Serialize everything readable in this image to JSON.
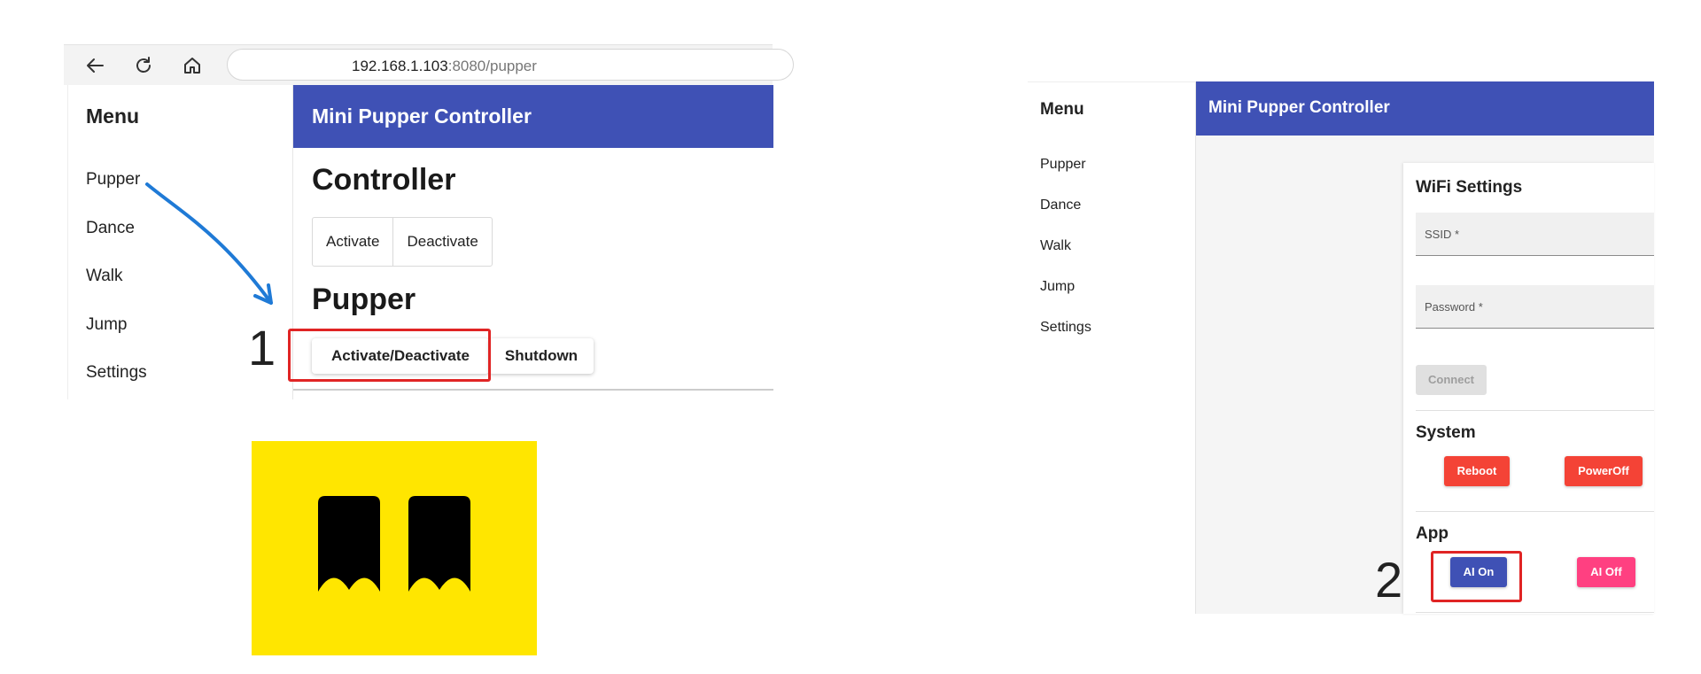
{
  "left_screenshot": {
    "browser": {
      "url_host": "192.168.1.103",
      "url_rest": ":8080/pupper",
      "icons": [
        "back-arrow-icon",
        "reload-icon",
        "home-icon"
      ]
    },
    "menu": {
      "title": "Menu",
      "items": [
        "Pupper",
        "Dance",
        "Walk",
        "Jump",
        "Settings"
      ]
    },
    "header_title": "Mini Pupper Controller",
    "controller": {
      "heading": "Controller",
      "buttons": [
        "Activate",
        "Deactivate"
      ]
    },
    "pupper": {
      "heading": "Pupper",
      "buttons": [
        "Activate/Deactivate",
        "Shutdown"
      ]
    },
    "callout_number": "1"
  },
  "right_screenshot": {
    "menu": {
      "title": "Menu",
      "items": [
        "Pupper",
        "Dance",
        "Walk",
        "Jump",
        "Settings"
      ]
    },
    "header_title": "Mini Pupper Controller",
    "wifi": {
      "heading": "WiFi Settings",
      "ssid_label": "SSID *",
      "password_label": "Password *",
      "connect_label": "Connect"
    },
    "system": {
      "heading": "System",
      "reboot_label": "Reboot",
      "poweroff_label": "PowerOff"
    },
    "app": {
      "heading": "App",
      "ai_on_label": "AI On",
      "ai_off_label": "AI Off"
    },
    "callout_number": "2"
  },
  "colors": {
    "header_blue": "#3f51b5",
    "annotation_red": "#e02424",
    "arrow_blue": "#1f7ad6",
    "danger_red": "#f44336",
    "pink": "#ff4081",
    "logo_yellow": "#ffe600"
  }
}
